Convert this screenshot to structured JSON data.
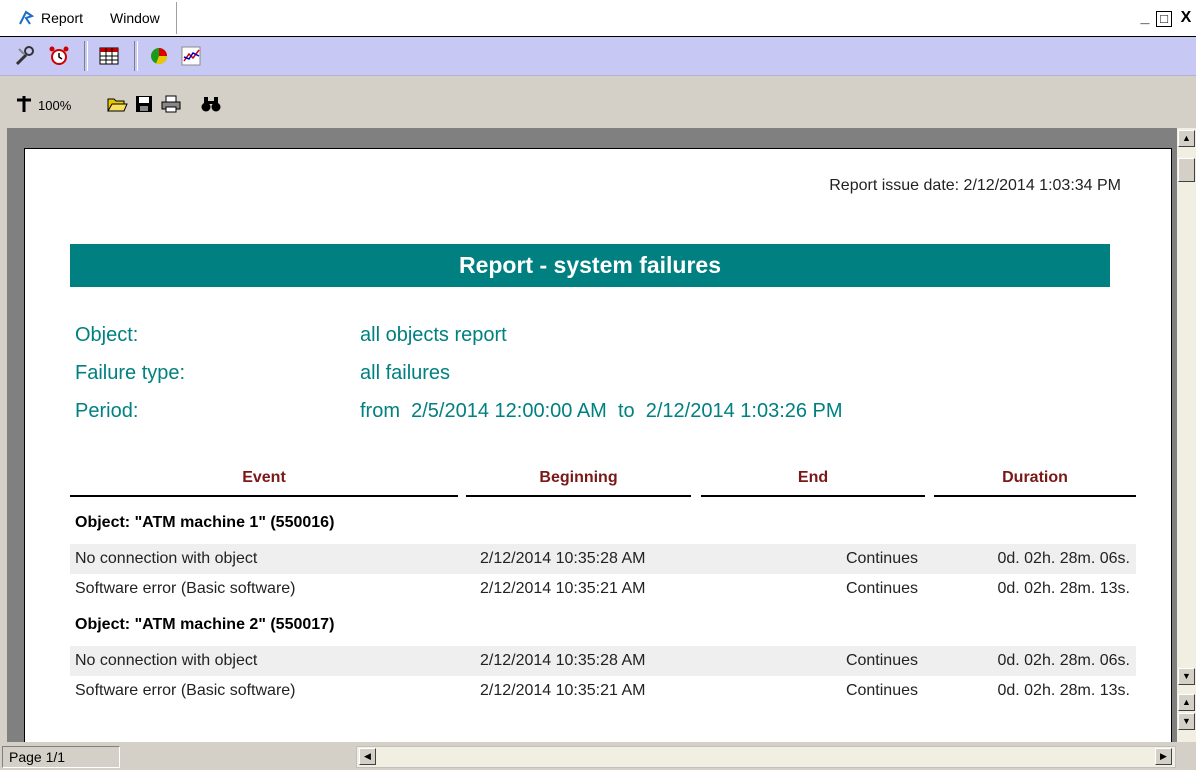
{
  "app": {
    "menu": [
      "Report",
      "Window"
    ],
    "window_controls": [
      "_",
      "□",
      "X"
    ]
  },
  "toolbar_main": {
    "icons": [
      "settings-icon",
      "alarm-clock-icon",
      "report-sheet-icon",
      "pie-chart-icon",
      "line-graph-icon"
    ]
  },
  "toolbar_report": {
    "zoom": "100%",
    "icons": [
      "zoom-cross-icon",
      "open-folder-icon",
      "save-icon",
      "print-icon",
      "find-binoculars-icon"
    ]
  },
  "report": {
    "issue_date": "Report issue date: 2/12/2014 1:03:34 PM",
    "title": "Report - system failures",
    "meta": {
      "object_label": "Object:",
      "object_value": "all objects report",
      "failure_label": "Failure type:",
      "failure_value": "all failures",
      "period_label": "Period:",
      "period_value": "from  2/5/2014 12:00:00 AM  to  2/12/2014 1:03:26 PM"
    },
    "columns": [
      "Event",
      "Beginning",
      "End",
      "Duration"
    ],
    "groups": [
      {
        "header": "Object: \"ATM machine 1\" (550016)",
        "rows": [
          {
            "event": "No connection with object",
            "begin": "2/12/2014 10:35:28 AM",
            "end": "Continues",
            "duration": "0d. 02h. 28m. 06s."
          },
          {
            "event": "Software error (Basic software)",
            "begin": "2/12/2014 10:35:21 AM",
            "end": "Continues",
            "duration": "0d. 02h. 28m. 13s."
          }
        ]
      },
      {
        "header": "Object: \"ATM machine 2\" (550017)",
        "rows": [
          {
            "event": "No connection with object",
            "begin": "2/12/2014 10:35:28 AM",
            "end": "Continues",
            "duration": "0d. 02h. 28m. 06s."
          },
          {
            "event": "Software error (Basic software)",
            "begin": "2/12/2014 10:35:21 AM",
            "end": "Continues",
            "duration": "0d. 02h. 28m. 13s."
          }
        ]
      }
    ]
  },
  "status": {
    "page": "Page 1/1"
  },
  "colors": {
    "accent": "#008080",
    "header_text": "#7a1818",
    "toolbar_bg": "#c8c8f4"
  }
}
